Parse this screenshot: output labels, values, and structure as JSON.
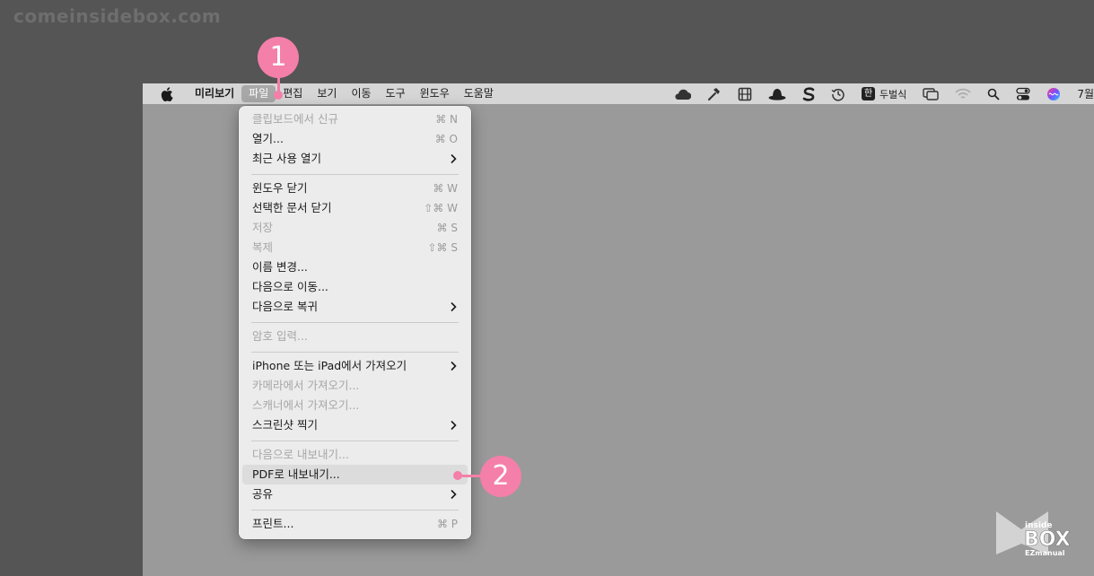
{
  "watermark": "comeinsidebox.com",
  "menubar": {
    "app_name": "미리보기",
    "items": [
      "파일",
      "편집",
      "보기",
      "이동",
      "도구",
      "윈도우",
      "도움말"
    ],
    "active_index": 0,
    "input_source": "한",
    "input_label": "두벌식",
    "clock_text": "7월"
  },
  "file_menu": {
    "items": [
      {
        "label": "클립보드에서 신규",
        "shortcut": "⌘ N",
        "enabled": false
      },
      {
        "label": "열기...",
        "shortcut": "⌘ O",
        "enabled": true
      },
      {
        "label": "최근 사용 열기",
        "submenu": true,
        "enabled": true
      },
      {
        "label": "윈도우 닫기",
        "shortcut": "⌘ W",
        "enabled": true
      },
      {
        "label": "선택한 문서 닫기",
        "shortcut": "⇧⌘ W",
        "enabled": true
      },
      {
        "label": "저장",
        "shortcut": "⌘ S",
        "enabled": false
      },
      {
        "label": "복제",
        "shortcut": "⇧⌘ S",
        "enabled": false
      },
      {
        "label": "이름 변경...",
        "enabled": true
      },
      {
        "label": "다음으로 이동...",
        "enabled": true
      },
      {
        "label": "다음으로 복귀",
        "submenu": true,
        "enabled": true
      },
      {
        "label": "암호 입력...",
        "enabled": false
      },
      {
        "label": "iPhone 또는 iPad에서 가져오기",
        "submenu": true,
        "enabled": true
      },
      {
        "label": "카메라에서 가져오기...",
        "enabled": false
      },
      {
        "label": "스캐너에서 가져오기...",
        "enabled": false
      },
      {
        "label": "스크린샷 찍기",
        "submenu": true,
        "enabled": true
      },
      {
        "label": "다음으로 내보내기...",
        "enabled": false
      },
      {
        "label": "PDF로 내보내기...",
        "enabled": true,
        "highlighted": true
      },
      {
        "label": "공유",
        "submenu": true,
        "enabled": true
      },
      {
        "label": "프린트...",
        "shortcut": "⌘ P",
        "enabled": true
      }
    ]
  },
  "annotations": {
    "step1": "1",
    "step2": "2",
    "color": "#f47fa8"
  },
  "logo": {
    "line1": "inside",
    "line2": "BOX",
    "line3": "EZmanual"
  }
}
